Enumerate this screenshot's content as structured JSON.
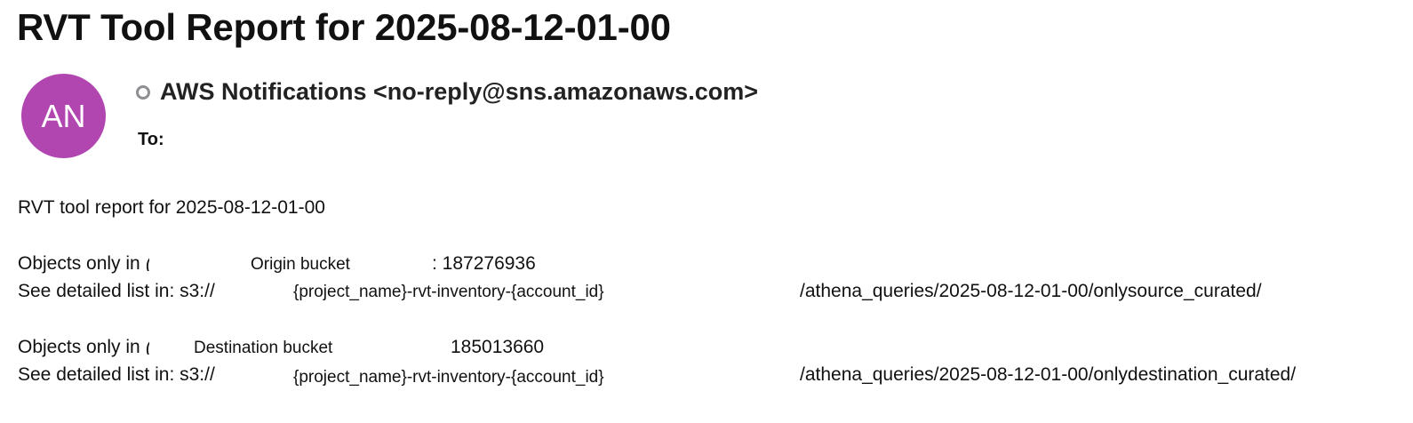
{
  "email": {
    "subject": "RVT Tool Report for 2025-08-12-01-00",
    "sender": {
      "avatar_initials": "AN",
      "avatar_color": "#b146b0",
      "display": "AWS Notifications <no-reply@sns.amazonaws.com>",
      "to_label": "To:"
    },
    "body": {
      "intro": "RVT tool report for 2025-08-12-01-00",
      "origin": {
        "objects_prefix": "Objects only in",
        "bucket_label": "Origin bucket",
        "count": ": 187276936",
        "see_prefix": "See detailed list in: s3://",
        "bucket_name": "{project_name}-rvt-inventory-{account_id}",
        "path": "/athena_queries/2025-08-12-01-00/onlysource_curated/"
      },
      "destination": {
        "objects_prefix": "Objects only in",
        "bucket_label": "Destination bucket",
        "count": "185013660",
        "see_prefix": "See detailed list in: s3://",
        "bucket_name": "{project_name}-rvt-inventory-{account_id}",
        "path": "/athena_queries/2025-08-12-01-00/onlydestination_curated/"
      }
    }
  }
}
